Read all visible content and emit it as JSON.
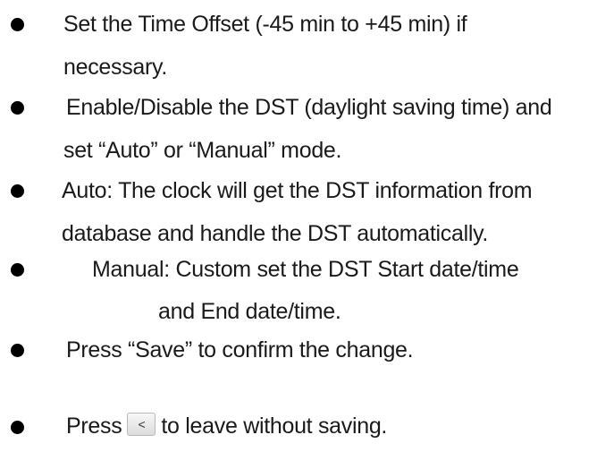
{
  "items": [
    {
      "lines": [
        "Set the Time Offset (-45 min to +45 min) if",
        "necessary."
      ]
    },
    {
      "lines": [
        "Enable/Disable the DST (daylight saving time) and",
        "set “Auto” or “Manual” mode."
      ]
    },
    {
      "lines": [
        "Auto: The clock will get the DST information from",
        "database and handle the DST automatically."
      ]
    },
    {
      "lines": [
        "Manual: Custom set the DST Start date/time",
        "and End date/time."
      ]
    },
    {
      "lines": [
        "Press “Save” to confirm the change."
      ]
    },
    {
      "before": "Press",
      "button_label": "<",
      "button_icon": "back-arrow-icon",
      "after": "to leave without saving."
    }
  ],
  "colors": {
    "text": "#1a1a1a",
    "bullet": "#000000"
  }
}
